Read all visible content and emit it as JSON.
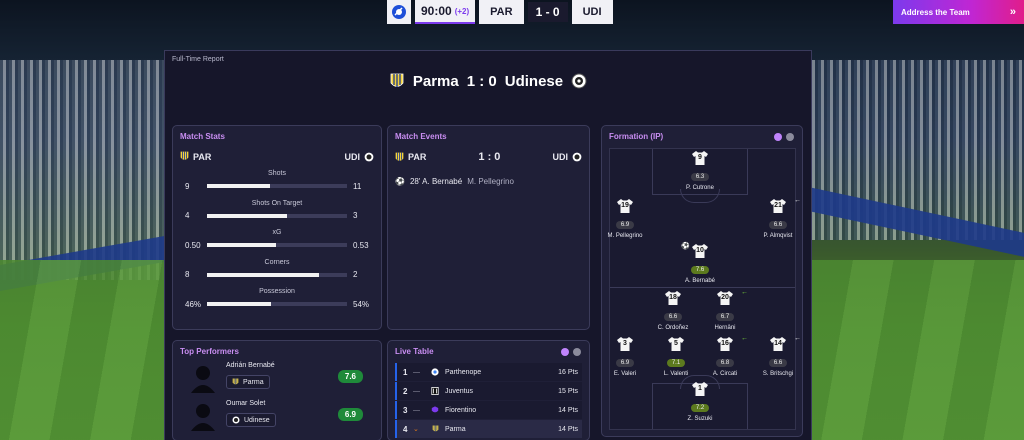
{
  "scoreboard": {
    "time": "90:00",
    "added_time": "(+2)",
    "home_abbr": "PAR",
    "score": "1 - 0",
    "away_abbr": "UDI"
  },
  "address_button": {
    "label": "Address the Team",
    "icon": "double-chevron-right-icon"
  },
  "panel": {
    "label": "Full-Time Report",
    "home": "Parma",
    "score": "1 : 0",
    "away": "Udinese"
  },
  "match_stats": {
    "title": "Match Stats",
    "home": "PAR",
    "away": "UDI",
    "rows": [
      {
        "label": "Shots",
        "home": "9",
        "away": "11",
        "home_share": 0.45
      },
      {
        "label": "Shots On Target",
        "home": "4",
        "away": "3",
        "home_share": 0.57
      },
      {
        "label": "xG",
        "home": "0.50",
        "away": "0.53",
        "home_share": 0.49
      },
      {
        "label": "Corners",
        "home": "8",
        "away": "2",
        "home_share": 0.8
      },
      {
        "label": "Possession",
        "home": "46%",
        "away": "54%",
        "home_share": 0.46
      }
    ]
  },
  "match_events": {
    "title": "Match Events",
    "home": "PAR",
    "score": "1 : 0",
    "away": "UDI",
    "events": [
      {
        "minute_scorer": "28' A. Bernabé",
        "assist": "M. Pellegrino",
        "icon": "ball-icon"
      }
    ]
  },
  "formation": {
    "title": "Formation (IP)",
    "players": [
      {
        "num": "9",
        "rating": "6.3",
        "name": "P. Cutrone",
        "good": false,
        "mark": ""
      },
      {
        "num": "19",
        "rating": "6.9",
        "name": "M. Pellegrino",
        "good": false,
        "mark": ""
      },
      {
        "num": "21",
        "rating": "6.6",
        "name": "P. Almqvist",
        "good": false,
        "mark": "out"
      },
      {
        "num": "10",
        "rating": "7.6",
        "name": "A. Bernabé",
        "good": true,
        "mark": "goal"
      },
      {
        "num": "18",
        "rating": "6.6",
        "name": "C. Ordoñez",
        "good": false,
        "mark": ""
      },
      {
        "num": "20",
        "rating": "6.7",
        "name": "Hernâni",
        "good": false,
        "mark": "in"
      },
      {
        "num": "3",
        "rating": "6.9",
        "name": "E. Valeri",
        "good": false,
        "mark": ""
      },
      {
        "num": "5",
        "rating": "7.1",
        "name": "L. Valenti",
        "good": true,
        "mark": ""
      },
      {
        "num": "16",
        "rating": "6.8",
        "name": "A. Circati",
        "good": false,
        "mark": "in"
      },
      {
        "num": "14",
        "rating": "6.6",
        "name": "S. Britschgi",
        "good": false,
        "mark": "out"
      },
      {
        "num": "1",
        "rating": "7.2",
        "name": "Z. Suzuki",
        "good": true,
        "mark": ""
      }
    ]
  },
  "top_performers": {
    "title": "Top Performers",
    "players": [
      {
        "name": "Adrián Bernabé",
        "club": "Parma",
        "rating": "7.6"
      },
      {
        "name": "Oumar Solet",
        "club": "Udinese",
        "rating": "6.9"
      }
    ]
  },
  "live_table": {
    "title": "Live Table",
    "rows": [
      {
        "pos": "1",
        "move": "—",
        "team": "Parthenope",
        "pts": "16 Pts",
        "highlight": false
      },
      {
        "pos": "2",
        "move": "—",
        "team": "Juventus",
        "pts": "15 Pts",
        "highlight": false
      },
      {
        "pos": "3",
        "move": "—",
        "team": "Fiorentino",
        "pts": "14 Pts",
        "highlight": false
      },
      {
        "pos": "4",
        "move": "⌄",
        "team": "Parma",
        "pts": "14 Pts",
        "highlight": true
      }
    ]
  },
  "colors": {
    "accent": "#7c3aed",
    "title": "#c98ef2",
    "good_rating": "#5c7a1e",
    "perf_rating": "#1f8a3a"
  }
}
